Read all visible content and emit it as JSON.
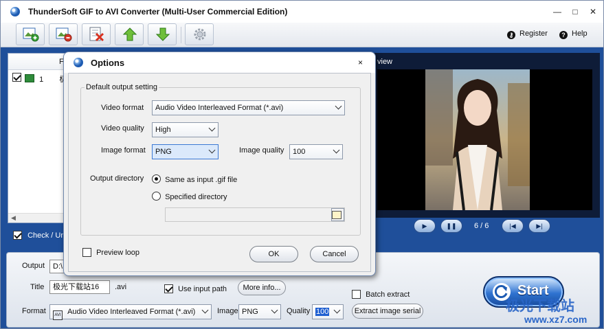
{
  "window": {
    "title": "ThunderSoft GIF to AVI Converter (Multi-User Commercial Edition)"
  },
  "window_controls": {
    "minimize": "—",
    "maximize": "□",
    "close": "✕"
  },
  "toolbar": {
    "buttons": [
      "add-file-icon",
      "remove-file-icon",
      "clear-list-icon",
      "move-up-icon",
      "move-down-icon",
      "settings-gear-icon"
    ],
    "register_label": "Register",
    "help_label": "Help"
  },
  "file_list": {
    "column_header": "F",
    "rows": [
      {
        "checked": true,
        "index": "1",
        "name_partial": "极"
      }
    ],
    "check_all_label": "Check / Unc"
  },
  "preview": {
    "label": "view",
    "page_info": "6 / 6",
    "controls": [
      "play",
      "pause",
      "first",
      "last"
    ]
  },
  "bottom": {
    "output_label": "Output",
    "output_value": "D:\\",
    "title_label": "Title",
    "title_value": "极光下载站16",
    "title_ext": ".avi",
    "use_input_path_label": "Use input path",
    "use_input_path_checked": true,
    "more_info_label": "More info...",
    "batch_extract_label": "Batch extract",
    "batch_extract_checked": false,
    "format_label": "Format",
    "format_value": "Audio Video Interleaved Format (*.avi)",
    "image_label": "Image",
    "image_value": "PNG",
    "quality_label": "Quality",
    "quality_value": "100",
    "extract_serial_label": "Extract image serial",
    "start_label": "Start"
  },
  "watermark": {
    "text": "极光下载站",
    "url": "www.xz7.com"
  },
  "dialog": {
    "title": "Options",
    "close": "×",
    "group_label": "Default output setting",
    "video_format_label": "Video format",
    "video_format_value": "Audio Video Interleaved Format (*.avi)",
    "video_quality_label": "Video quality",
    "video_quality_value": "High",
    "image_format_label": "Image format",
    "image_format_value": "PNG",
    "image_quality_label": "Image quality",
    "image_quality_value": "100",
    "output_dir_label": "Output directory",
    "same_as_input_label": "Same as input .gif file",
    "same_as_input_selected": true,
    "specified_dir_label": "Specified directory",
    "specified_dir_selected": false,
    "dir_path_value": "",
    "preview_loop_label": "Preview loop",
    "preview_loop_checked": false,
    "ok_label": "OK",
    "cancel_label": "Cancel"
  }
}
